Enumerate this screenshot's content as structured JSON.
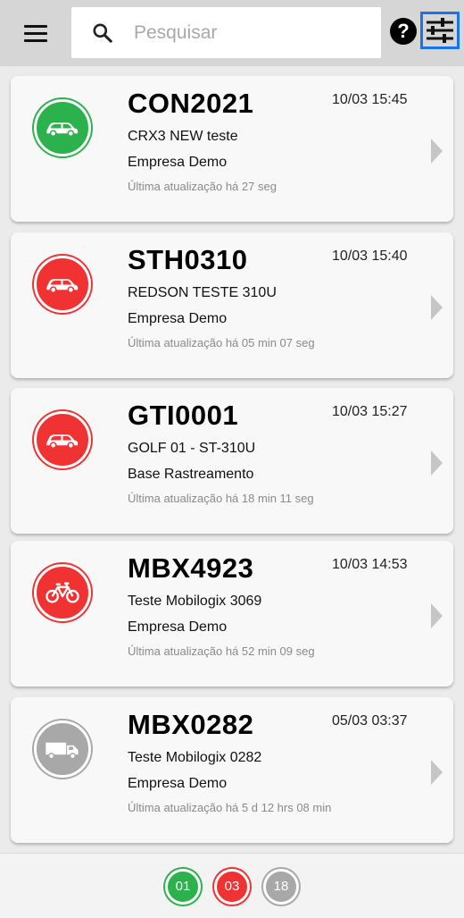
{
  "header": {
    "search_placeholder": "Pesquisar",
    "help_label": "?"
  },
  "colors": {
    "status_online": "#2bb24c",
    "status_offline": "#f03232",
    "status_inactive": "#a8a8a8",
    "filter_highlight": "#1a73e8"
  },
  "vehicles": [
    {
      "plate": "CON2021",
      "time": "10/03 15:45",
      "description": "CRX3 NEW teste",
      "company": "Empresa Demo",
      "updated": "Última atualização há 27 seg",
      "icon": "car-icon",
      "status": "online"
    },
    {
      "plate": "STH0310",
      "time": "10/03 15:40",
      "description": "REDSON TESTE 310U",
      "company": "Empresa Demo",
      "updated": "Última atualização há 05 min 07 seg",
      "icon": "car-icon",
      "status": "offline"
    },
    {
      "plate": "GTI0001",
      "time": "10/03 15:27",
      "description": "GOLF 01 - ST-310U",
      "company": "Base Rastreamento",
      "updated": "Última atualização há 18 min 11 seg",
      "icon": "car-icon",
      "status": "offline"
    },
    {
      "plate": "MBX4923",
      "time": "10/03 14:53",
      "description": "Teste Mobilogix 3069",
      "company": "Empresa Demo",
      "updated": "Última atualização há 52 min 09 seg",
      "icon": "bicycle-icon",
      "status": "offline"
    },
    {
      "plate": "MBX0282",
      "time": "05/03 03:37",
      "description": "Teste Mobilogix 0282",
      "company": "Empresa Demo",
      "updated": "Última atualização há 5 d 12 hrs 08 min",
      "icon": "truck-icon",
      "status": "inactive"
    }
  ],
  "status_counts": [
    {
      "label": "01",
      "status": "online"
    },
    {
      "label": "03",
      "status": "offline"
    },
    {
      "label": "18",
      "status": "inactive"
    }
  ]
}
